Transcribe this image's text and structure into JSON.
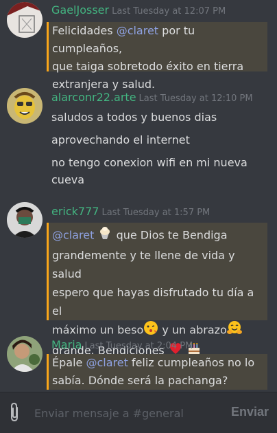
{
  "messages": [
    {
      "username": "GaelJosser",
      "timestamp": "Last Tuesday at 12:07 PM",
      "lines": [
        {
          "pre": "Felicidades ",
          "mention": "@claret",
          "post": " por tu cumpleaños,"
        },
        {
          "text": "que taiga sobretodo éxito en tierra"
        },
        {
          "text": "extranjera y salud."
        }
      ]
    },
    {
      "username": "alarconr22.arte",
      "timestamp": "Last Tuesday at 12:10 PM",
      "paragraphs": [
        "saludos a todos y buenos dias",
        "aprovechando el internet",
        "no tengo conexion wifi en mi nueva cueva"
      ]
    },
    {
      "username": "erick777",
      "timestamp": "Last Tuesday at 1:57 PM",
      "lines": [
        {
          "mention": "@claret",
          "post": " que Dios te Bendiga"
        },
        {
          "text": "grandemente y te llene de vida y salud"
        },
        {
          "text": "espero que hayas disfrutado tu día a el"
        },
        {
          "pre": "máximo un beso",
          "post": " y un abrazo"
        },
        {
          "pre": "grande. Bendiciones"
        }
      ],
      "emojis": [
        "ice-cream-icon",
        "kiss-face-icon",
        "hug-face-icon",
        "heart-icon",
        "cake-icon"
      ]
    },
    {
      "username": "Maria",
      "timestamp": "Last Tuesday at 2:04 PM",
      "lines": [
        {
          "pre": "Épale ",
          "mention": "@claret",
          "post": "  feliz cumpleaños no lo"
        },
        {
          "text": "sabía. Dónde será la pachanga?"
        }
      ]
    }
  ],
  "composer": {
    "placeholder": "Enviar mensaje a #general",
    "send_label": "Enviar",
    "attach_icon": "paperclip-icon"
  },
  "colors": {
    "background": "#36393f",
    "username": "#43b581",
    "mention_text": "#8ea1e1",
    "mention_highlight": "#4a473e",
    "mention_bar": "#faa61a"
  }
}
